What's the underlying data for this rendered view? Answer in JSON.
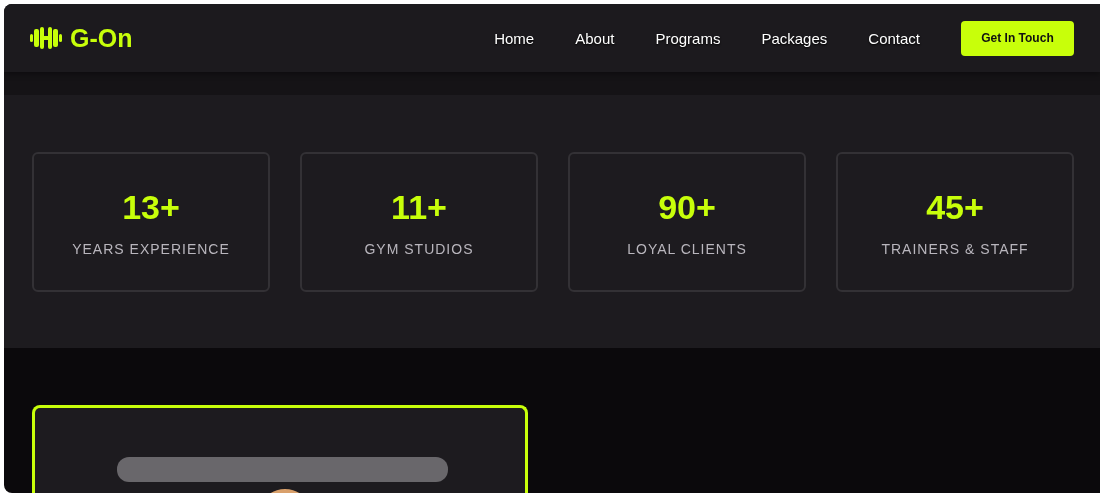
{
  "brand": {
    "name": "G-On"
  },
  "nav": [
    {
      "label": "Home"
    },
    {
      "label": "About"
    },
    {
      "label": "Programs"
    },
    {
      "label": "Packages"
    },
    {
      "label": "Contact"
    }
  ],
  "cta": {
    "label": "Get In Touch"
  },
  "stats": [
    {
      "value": "13+",
      "label": "YEARS EXPERIENCE"
    },
    {
      "value": "11+",
      "label": "GYM STUDIOS"
    },
    {
      "value": "90+",
      "label": "LOYAL CLIENTS"
    },
    {
      "value": "45+",
      "label": "TRAINERS & STAFF"
    }
  ]
}
